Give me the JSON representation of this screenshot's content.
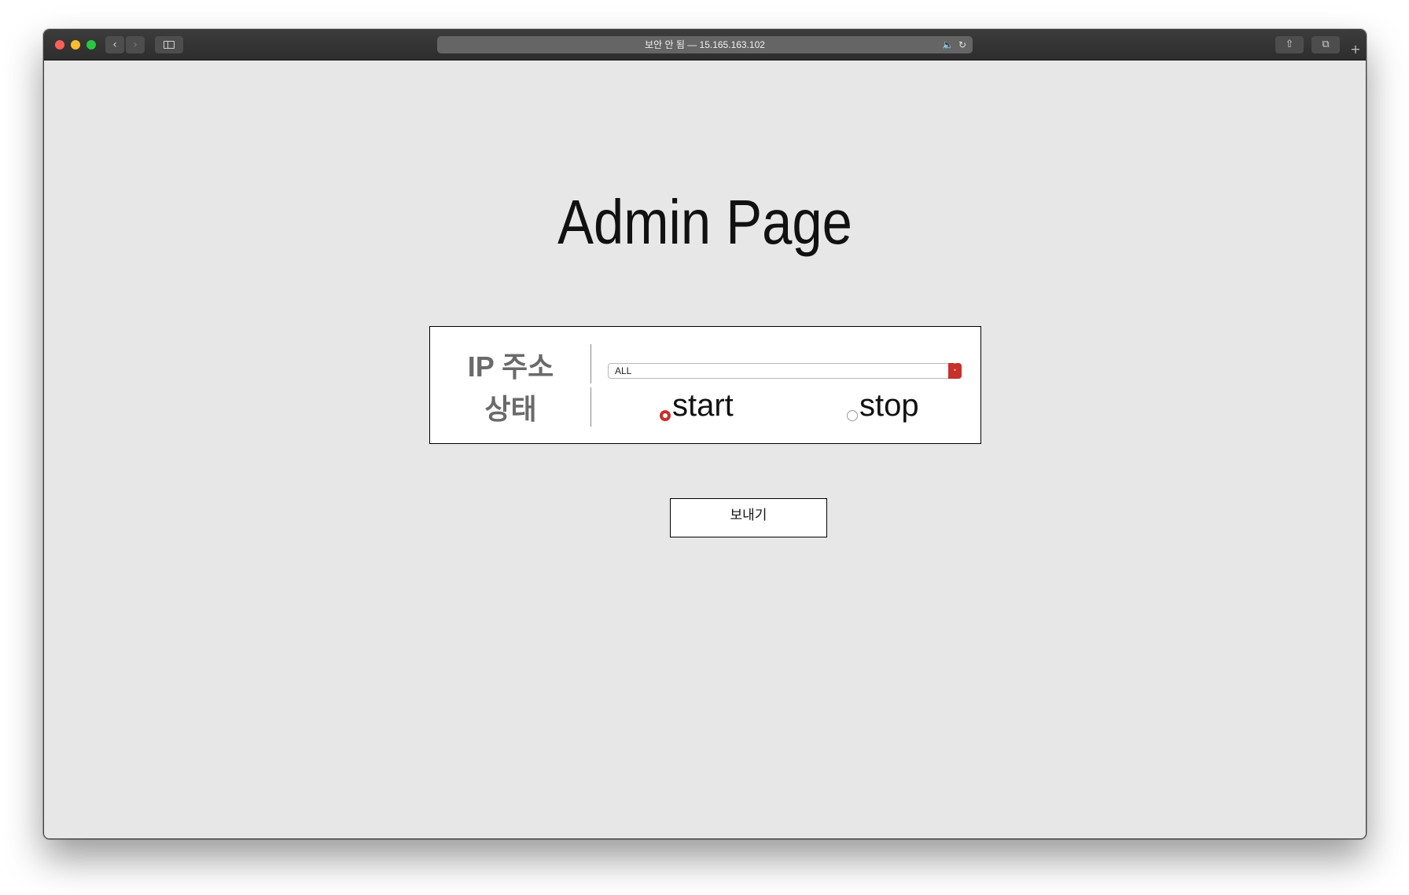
{
  "browser": {
    "url": "보안 안 됨 — 15.165.163.102",
    "icons": {
      "back": "chevron-left-icon",
      "forward": "chevron-right-icon",
      "sidebar": "sidebar-icon",
      "speaker": "speaker-icon",
      "reload": "reload-icon",
      "share": "share-icon",
      "tabs": "tabs-icon",
      "new_tab": "plus-icon"
    },
    "colors": {
      "close": "#fe5f57",
      "minimize": "#febc2e",
      "zoom": "#28c840"
    }
  },
  "page": {
    "title": "Admin Page",
    "form": {
      "ip_label": "IP 주소",
      "ip_value": "ALL",
      "status_label": "상태",
      "options": [
        {
          "label": "start",
          "checked": true
        },
        {
          "label": "stop",
          "checked": false
        }
      ]
    },
    "submit_label": "보내기",
    "colors": {
      "accent": "#c8302b",
      "background": "#e7e7e7"
    }
  }
}
